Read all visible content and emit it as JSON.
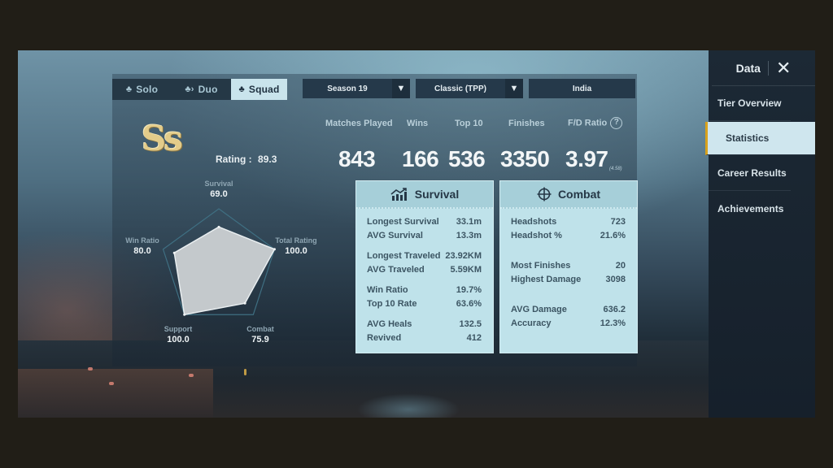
{
  "mode_tabs": [
    {
      "label": "Solo",
      "icon": "solo-icon",
      "active": false
    },
    {
      "label": "Duo",
      "icon": "duo-icon",
      "active": false
    },
    {
      "label": "Squad",
      "icon": "squad-icon",
      "active": true
    }
  ],
  "filters": {
    "season": "Season 19",
    "mode": "Classic (TPP)",
    "region": "India"
  },
  "tier": {
    "badge": "Ss",
    "rating_label": "Rating :",
    "rating_value": "89.3"
  },
  "radar": {
    "axes": [
      {
        "name": "Survival",
        "value": "69.0"
      },
      {
        "name": "Total Rating",
        "value": "100.0"
      },
      {
        "name": "Combat",
        "value": "75.9"
      },
      {
        "name": "Support",
        "value": "100.0"
      },
      {
        "name": "Win Ratio",
        "value": "80.0"
      }
    ],
    "max": 100
  },
  "headline": [
    {
      "label": "Matches Played",
      "value": "843"
    },
    {
      "label": "Wins",
      "value": "166"
    },
    {
      "label": "Top 10",
      "value": "536"
    },
    {
      "label": "Finishes",
      "value": "3350"
    },
    {
      "label": "F/D Ratio",
      "value": "3.97",
      "sub": "(4.58)"
    }
  ],
  "survival_card": {
    "title": "Survival",
    "groups": [
      [
        {
          "label": "Longest Survival",
          "value": "33.1m"
        },
        {
          "label": "AVG Survival",
          "value": "13.3m"
        }
      ],
      [
        {
          "label": "Longest Traveled",
          "value": "23.92KM"
        },
        {
          "label": "AVG Traveled",
          "value": "5.59KM"
        }
      ],
      [
        {
          "label": "Win Ratio",
          "value": "19.7%"
        },
        {
          "label": "Top 10 Rate",
          "value": "63.6%"
        }
      ],
      [
        {
          "label": "AVG Heals",
          "value": "132.5"
        },
        {
          "label": "Revived",
          "value": "412"
        }
      ]
    ]
  },
  "combat_card": {
    "title": "Combat",
    "groups": [
      [
        {
          "label": "Headshots",
          "value": "723"
        },
        {
          "label": "Headshot %",
          "value": "21.6%"
        }
      ],
      [
        {
          "label": "Most Finishes",
          "value": "20"
        },
        {
          "label": "Highest Damage",
          "value": "3098"
        }
      ],
      [
        {
          "label": "AVG Damage",
          "value": "636.2"
        },
        {
          "label": "Accuracy",
          "value": "12.3%"
        }
      ]
    ]
  },
  "sidebar": {
    "title": "Data",
    "items": [
      {
        "label": "Tier Overview",
        "active": false
      },
      {
        "label": "Statistics",
        "active": true
      },
      {
        "label": "Career Results",
        "active": false
      },
      {
        "label": "Achievements",
        "active": false
      }
    ]
  },
  "colors": {
    "accent_active_tab": "#c9e4ec",
    "nav_highlight": "#d9a21c",
    "card_bg": "#bfe2ea",
    "tier_gold": "#e3cc8a"
  }
}
